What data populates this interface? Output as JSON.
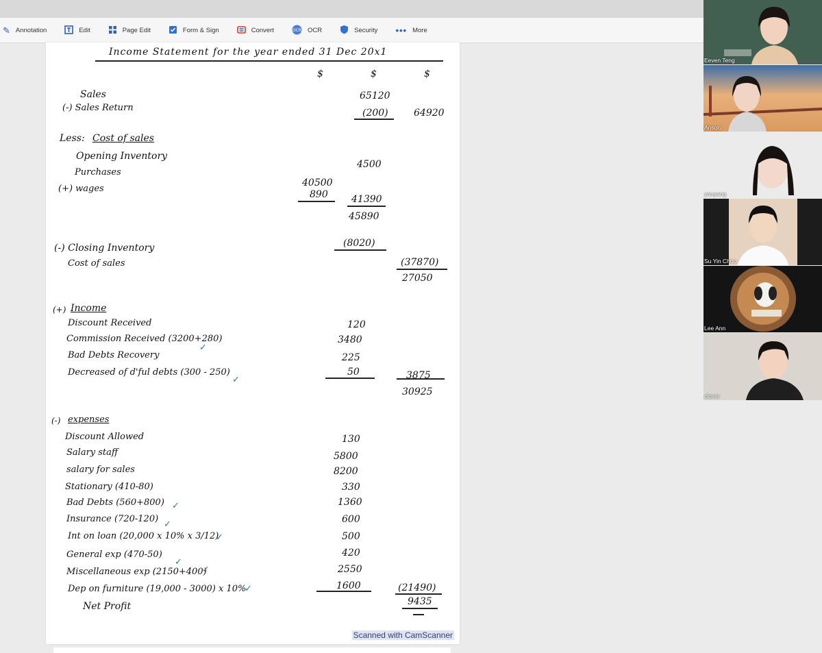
{
  "toolbar": {
    "items": [
      {
        "label": "Annotation",
        "icon": "pen-icon"
      },
      {
        "label": "Edit",
        "icon": "edit-icon"
      },
      {
        "label": "Page Edit",
        "icon": "grid-icon"
      },
      {
        "label": "Form & Sign",
        "icon": "checkbox-icon"
      },
      {
        "label": "Convert",
        "icon": "convert-icon"
      },
      {
        "label": "OCR",
        "icon": "ocr-icon"
      },
      {
        "label": "Security",
        "icon": "shield-icon"
      },
      {
        "label": "More",
        "icon": "more-icon"
      }
    ]
  },
  "document": {
    "title": "Income Statement for the year ended 31 Dec 20x1",
    "col_headers": [
      "$",
      "$",
      "$"
    ],
    "lines": {
      "sales": "Sales",
      "sales_value": "65120",
      "sales_return": "(-) Sales Return",
      "sales_return_value": "(200)",
      "net_sales": "64920",
      "less_cos": "Less:",
      "cost_of_sales_heading": "Cost of sales",
      "opening_inventory": "Opening Inventory",
      "opening_inventory_value": "4500",
      "purchases": "Purchases",
      "purchases_value": "40500",
      "wages": "(+) wages",
      "wages_value": "890",
      "purch_wages_total": "41390",
      "subtotal": "45890",
      "closing_inventory": "(-) Closing Inventory",
      "closing_inventory_value": "(8020)",
      "cost_of_sales": "Cost of sales",
      "cost_of_sales_value": "(37870)",
      "gross_profit": "27050",
      "income_prefix": "(+)",
      "income_heading": "Income",
      "discount_received": "Discount Received",
      "discount_received_value": "120",
      "commission_received": "Commission Received (3200+280)",
      "commission_received_value": "3480",
      "bad_debts_recovery": "Bad Debts Recovery",
      "bad_debts_recovery_value": "225",
      "decrease_dd": "Decreased of d'ful debts (300 - 250)",
      "decrease_dd_value": "50",
      "income_total": "3875",
      "total_after_income": "30925",
      "expenses_prefix": "(-)",
      "expenses_heading": "expenses",
      "discount_allowed": "Discount Allowed",
      "discount_allowed_value": "130",
      "salary_staff": "Salary staff",
      "salary_staff_value": "5800",
      "salary_sales": "salary for sales",
      "salary_sales_value": "8200",
      "stationary": "Stationary (410-80)",
      "stationary_value": "330",
      "bad_debts": "Bad Debts (560+800)",
      "bad_debts_value": "1360",
      "insurance": "Insurance (720-120)",
      "insurance_value": "600",
      "interest_loan": "Int on loan (20,000 x 10% x 3/12)",
      "interest_loan_value": "500",
      "general_exp": "General exp (470-50)",
      "general_exp_value": "420",
      "misc_exp": "Miscellaneous exp (2150+400)",
      "misc_exp_value": "2550",
      "dep_furniture": "Dep on furniture (19,000 - 3000) x 10%",
      "dep_furniture_value": "1600",
      "expenses_total": "(21490)",
      "net_profit": "Net Profit",
      "net_profit_value": "9435"
    },
    "watermark": "Scanned with CamScanner"
  },
  "participants": [
    {
      "name": "Eeven Teng"
    },
    {
      "name": "Anson"
    },
    {
      "name": "youyang"
    },
    {
      "name": "Su Yin Choo"
    },
    {
      "name": "Lee Ann"
    },
    {
      "name": "clover"
    }
  ],
  "tick_mark": "✓"
}
